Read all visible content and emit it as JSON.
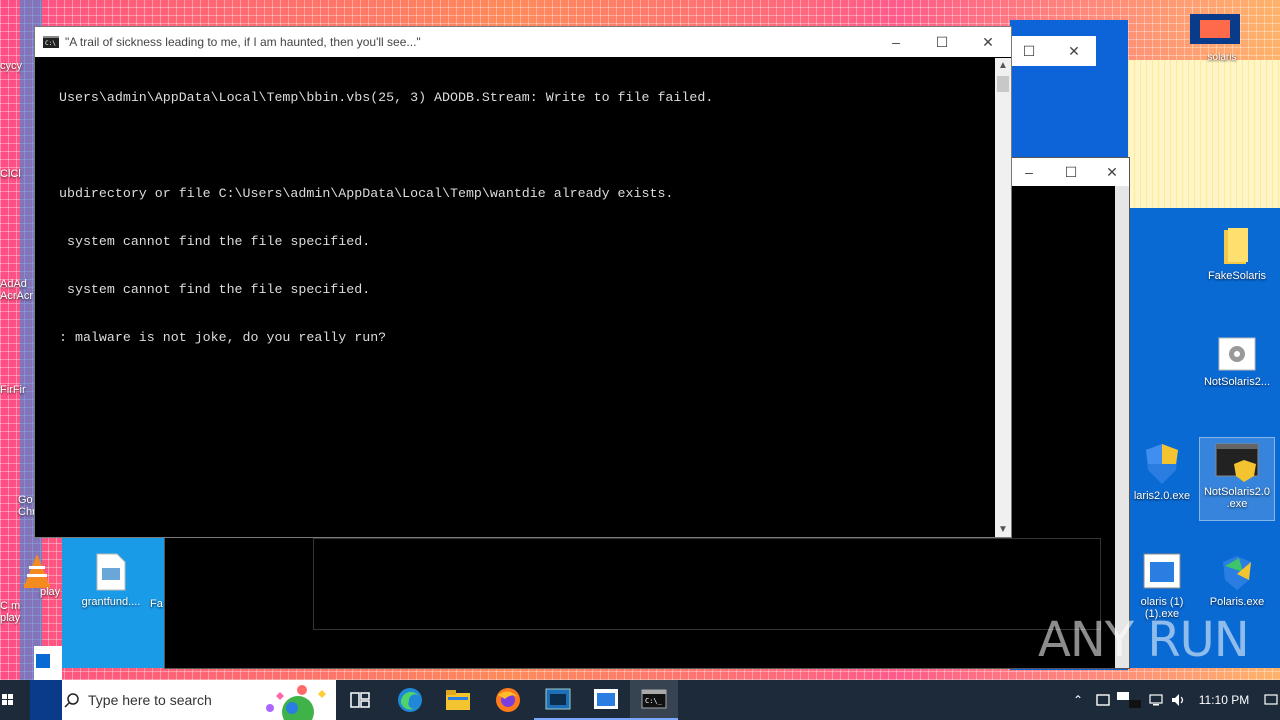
{
  "front_window": {
    "title": "\"A trail of sickness leading to me, if I am haunted, then you'll see...\"",
    "lines": [
      "Users\\admin\\AppData\\Local\\Temp\\bbin.vbs(25, 3) ADODB.Stream: Write to file failed.",
      "",
      "ubdirectory or file C:\\Users\\admin\\AppData\\Local\\Temp\\wantdie already exists.",
      " system cannot find the file specified.",
      " system cannot find the file specified.",
      ": malware is not joke, do you really run?"
    ]
  },
  "desktop_icons": {
    "fake_solaris": "FakeSolaris",
    "not_solaris2": "NotSolaris2...",
    "laris_exe": "laris2.0.exe",
    "not_solaris_exe": "NotSolaris2.0\n.exe",
    "olaris_1": "olaris (1)\n(1).exe",
    "polaris": "Polaris.exe",
    "grantfund": "grantfund....",
    "fa": "Fa",
    "solaris_top": "solaris",
    "left_cy": "cycy",
    "left_cl": "ClCl",
    "left_ad": "AdAd\nAcrAcr",
    "left_fir": "FirFir",
    "left_go": "Go\nChr",
    "left_vlc": "C m\nplay",
    "left_vlc2": "play"
  },
  "taskbar": {
    "search_placeholder": "Type here to search",
    "time": "11:10 PM"
  },
  "watermark": "ANY RUN"
}
